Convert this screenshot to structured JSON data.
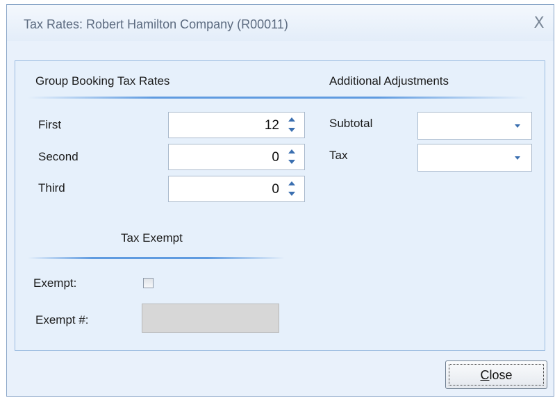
{
  "window": {
    "title": "Tax Rates: Robert Hamilton Company (R00011)",
    "close_glyph": "X"
  },
  "group_booking": {
    "heading": "Group Booking Tax  Rates",
    "rows": [
      {
        "label": "First",
        "value": "12"
      },
      {
        "label": "Second",
        "value": "0"
      },
      {
        "label": "Third",
        "value": "0"
      }
    ]
  },
  "adjustments": {
    "heading": "Additional Adjustments",
    "subtotal_label": "Subtotal",
    "subtotal_value": "",
    "tax_label": "Tax",
    "tax_value": ""
  },
  "tax_exempt": {
    "heading": "Tax Exempt",
    "exempt_label": "Exempt:",
    "exempt_checked": false,
    "exempt_number_label": "Exempt #:",
    "exempt_number_value": ""
  },
  "buttons": {
    "close_mnemonic": "C",
    "close_rest": "lose"
  },
  "colors": {
    "accent": "#5f9be0",
    "panel_bg": "#e6f0fb",
    "spin_arrow": "#3b6fb0"
  }
}
